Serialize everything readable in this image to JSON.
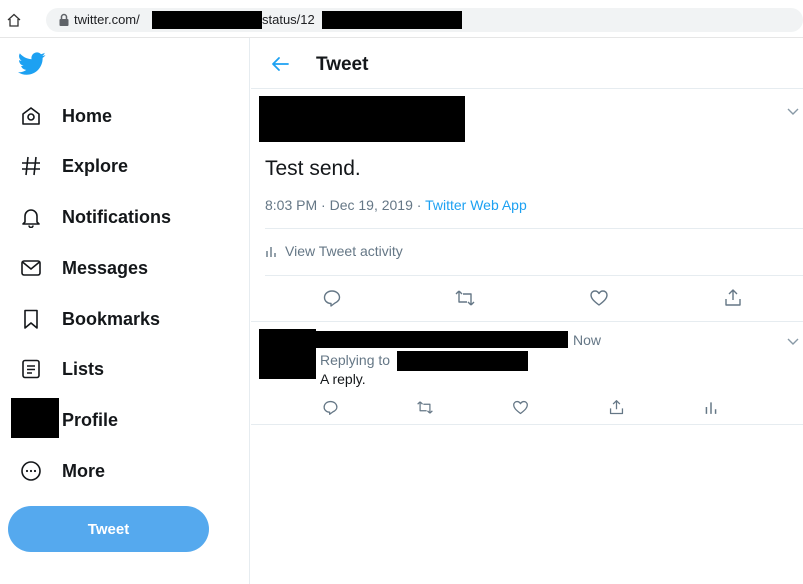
{
  "browser": {
    "url_domain": "twitter.com/",
    "url_path": "status/12"
  },
  "sidebar": {
    "items": [
      {
        "label": "Home",
        "icon": "home-icon"
      },
      {
        "label": "Explore",
        "icon": "hashtag-icon"
      },
      {
        "label": "Notifications",
        "icon": "bell-icon"
      },
      {
        "label": "Messages",
        "icon": "envelope-icon"
      },
      {
        "label": "Bookmarks",
        "icon": "bookmark-icon"
      },
      {
        "label": "Lists",
        "icon": "list-icon"
      },
      {
        "label": "Profile",
        "icon": "avatar-redacted"
      },
      {
        "label": "More",
        "icon": "more-circle-icon"
      }
    ],
    "tweet_button": "Tweet"
  },
  "header": {
    "title": "Tweet"
  },
  "tweet": {
    "text": "Test send.",
    "time": "8:03 PM · Dec 19, 2019",
    "separator": " · ",
    "source": "Twitter Web App",
    "activity_label": "View Tweet activity"
  },
  "reply": {
    "time": "Now",
    "replying_to": "Replying to",
    "text": "A reply."
  },
  "colors": {
    "accent": "#1da1f2",
    "tweet_button": "#55a9ee",
    "secondary_text": "#657786"
  }
}
